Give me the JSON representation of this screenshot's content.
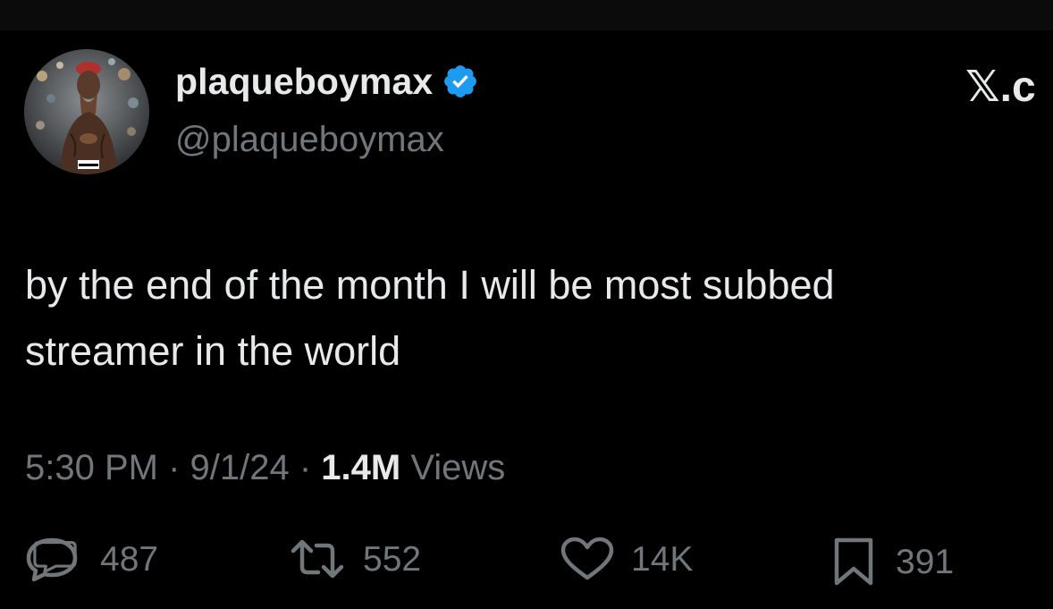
{
  "author": {
    "display_name": "plaqueboymax",
    "handle": "@plaqueboymax",
    "verified": true,
    "verified_color": "#1d9bf0"
  },
  "branding": {
    "logo_text": "𝕏.c"
  },
  "tweet": {
    "line1": "by the end of the month I will be most subbed",
    "line2": "streamer in the world"
  },
  "meta": {
    "time": "5:30 PM",
    "separator": " · ",
    "date": "9/1/24",
    "views_count": "1.4M",
    "views_label": " Views"
  },
  "actions": {
    "replies": "487",
    "reposts": "552",
    "likes": "14K",
    "bookmarks": "391"
  },
  "icons": {
    "reply": "speech-bubble-icon",
    "repost": "retweet-arrows-icon",
    "like": "heart-icon",
    "bookmark": "bookmark-icon",
    "verified": "verified-badge-icon"
  },
  "colors": {
    "background": "#000000",
    "text": "#e7e9ea",
    "secondary": "#71767b"
  }
}
